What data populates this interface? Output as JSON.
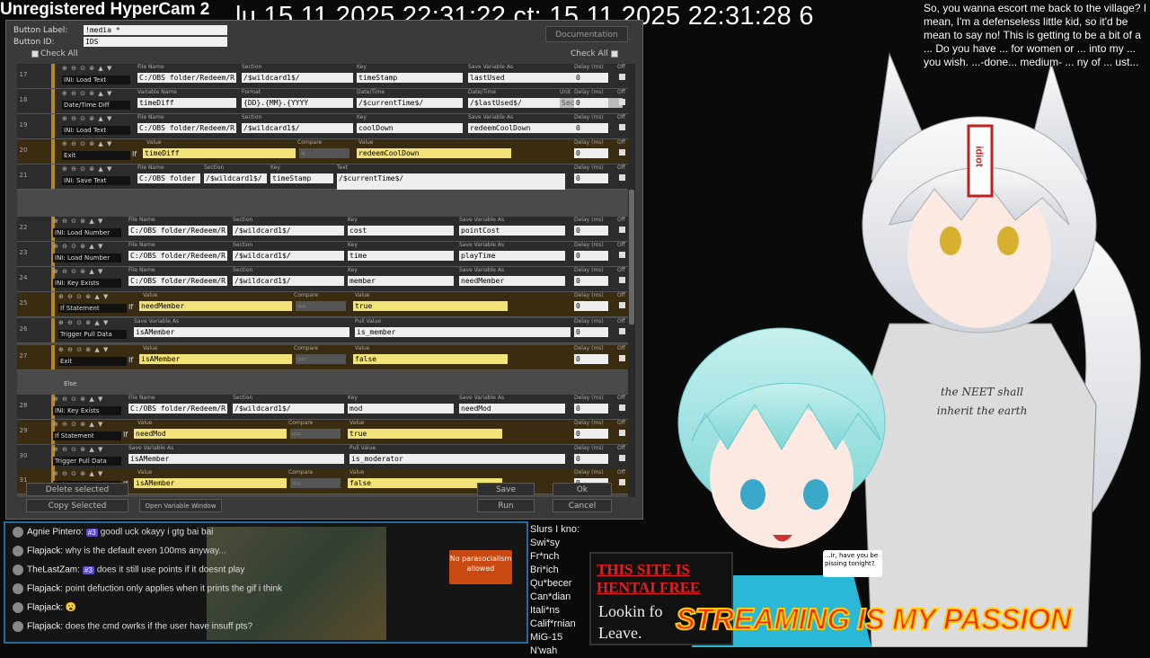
{
  "recorder_watermark": "Unregistered HyperCam 2",
  "clock_text": "lu 15.11.2025 22:31:22 ct: 15.11.2025 22:31:28 6",
  "dialog": {
    "button_label_caption": "Button Label:",
    "button_label_value": "!media *",
    "button_id_caption": "Button ID:",
    "button_id_value": "IDS",
    "documentation_label": "Documentation",
    "check_all_left": "Check All",
    "check_all_right": "Check All",
    "delete_selected": "Delete selected",
    "copy_selected": "Copy Selected",
    "open_variable_window": "Open Variable Window",
    "save": "Save",
    "ok": "Ok",
    "run": "Run",
    "cancel": "Cancel",
    "else_label": "Else",
    "rows": [
      {
        "num": "17",
        "action": "INI: Load Text",
        "kind": "ini",
        "f1l": "File Name",
        "f1": "C:/OBS folder/Redeem/R",
        "f2l": "Section",
        "f2": "/$wildcard1$/",
        "f3l": "Key",
        "f3": "timeStamp",
        "f4l": "Save Variable As",
        "f4": "lastUsed",
        "delay": "0"
      },
      {
        "num": "18",
        "action": "Date/Time Diff",
        "kind": "date",
        "f1l": "Variable Name",
        "f1": "timeDiff",
        "f2l": "Format",
        "f2": "{DD}.{MM}.{YYYY",
        "f3l": "Date/Time",
        "f3": "/$currentTime$/",
        "f4l": "Date/Time",
        "f4": "/$lastUsed$/",
        "f5l": "Unit",
        "f5": "Seconds",
        "delay": "0"
      },
      {
        "num": "19",
        "action": "INI: Load Text",
        "kind": "ini",
        "f1l": "File Name",
        "f1": "C:/OBS folder/Redeem/R",
        "f2l": "Section",
        "f2": "/$wildcard1$/",
        "f3l": "Key",
        "f3": "coolDown",
        "f4l": "Save Variable As",
        "f4": "redeemCoolDown",
        "delay": "0"
      },
      {
        "num": "20",
        "action": "Exit",
        "kind": "if",
        "cond": "If",
        "vl": "Value",
        "v1": "timeDiff",
        "cl": "Compare",
        "c": "<",
        "v2l": "Value",
        "v2": "redeemCoolDown",
        "delay": "0"
      },
      {
        "num": "21",
        "action": "INI: Save Text",
        "kind": "save",
        "f1l": "File Name",
        "f1": "C:/OBS folder",
        "f2l": "Section",
        "f2": "/$wildcard1$/",
        "f3l": "Key",
        "f3": "timeStamp",
        "f4l": "Text",
        "f4": "/$currentTime$/",
        "delay": "0"
      },
      {
        "num": "22",
        "action": "INI: Load Number",
        "kind": "ini",
        "f1l": "File Name",
        "f1": "C:/OBS folder/Redeem/R",
        "f2l": "Section",
        "f2": "/$wildcard1$/",
        "f3l": "Key",
        "f3": "cost",
        "f4l": "Save Variable As",
        "f4": "pointCost",
        "delay": "0"
      },
      {
        "num": "23",
        "action": "INI: Load Number",
        "kind": "ini",
        "f1l": "File Name",
        "f1": "C:/OBS folder/Redeem/R",
        "f2l": "Section",
        "f2": "/$wildcard1$/",
        "f3l": "Key",
        "f3": "time",
        "f4l": "Save Variable As",
        "f4": "playTime",
        "delay": "0"
      },
      {
        "num": "24",
        "action": "INI: Key Exists",
        "kind": "ini",
        "f1l": "File Name",
        "f1": "C:/OBS folder/Redeem/R",
        "f2l": "Section",
        "f2": "/$wildcard1$/",
        "f3l": "Key",
        "f3": "member",
        "f4l": "Save Variable As",
        "f4": "needMember",
        "delay": "0"
      },
      {
        "num": "25",
        "action": "If Statement",
        "kind": "if",
        "cond": "If",
        "vl": "Value",
        "v1": "needMember",
        "cl": "Compare",
        "c": "==",
        "v2l": "Value",
        "v2": "true",
        "delay": "0"
      },
      {
        "num": "26",
        "action": "Trigger Pull Data",
        "kind": "pull",
        "f1l": "Save Variable As",
        "f1": "isAMember",
        "f2l": "Pull Value",
        "f2": "is_member",
        "delay": "0"
      },
      {
        "num": "27",
        "action": "Exit",
        "kind": "if",
        "cond": "If",
        "vl": "Value",
        "v1": "isAMember",
        "cl": "Compare",
        "c": "==",
        "v2l": "Value",
        "v2": "false",
        "delay": "0"
      },
      {
        "num": "28",
        "action": "INI: Key Exists",
        "kind": "ini",
        "f1l": "File Name",
        "f1": "C:/OBS folder/Redeem/R",
        "f2l": "Section",
        "f2": "/$wildcard1$/",
        "f3l": "Key",
        "f3": "mod",
        "f4l": "Save Variable As",
        "f4": "needMod",
        "delay": "0"
      },
      {
        "num": "29",
        "action": "If Statement",
        "kind": "if",
        "cond": "If",
        "vl": "Value",
        "v1": "needMod",
        "cl": "Compare",
        "c": "==",
        "v2l": "Value",
        "v2": "true",
        "delay": "0"
      },
      {
        "num": "30",
        "action": "Trigger Pull Data",
        "kind": "pull",
        "f1l": "Save Variable As",
        "f1": "isAMember",
        "f2l": "Pull Value",
        "f2": "is_moderator",
        "delay": "0"
      },
      {
        "num": "31",
        "action": "Exit",
        "kind": "if",
        "cond": "If",
        "vl": "Value",
        "v1": "isAMember",
        "cl": "Compare",
        "c": "==",
        "v2l": "Value",
        "v2": "false",
        "delay": "0"
      }
    ],
    "delay_label": "Delay (ms)",
    "off_label": "Off"
  },
  "chat": {
    "messages": [
      {
        "user": "Agnie Pintero:",
        "badge": "#3",
        "text": "goodl uck okayy i gtg bai bai"
      },
      {
        "user": "Flapjack:",
        "badge": "",
        "text": "why is the default even 100ms anyway..."
      },
      {
        "user": "TheLastZam:",
        "badge": "#3",
        "text": "does it still use points if it doesnt play"
      },
      {
        "user": "Flapjack:",
        "badge": "",
        "text": "point defuction only applies when it prints the gif i think"
      },
      {
        "user": "Flapjack:",
        "badge": "",
        "text": "😮"
      },
      {
        "user": "Flapjack:",
        "badge": "",
        "text": "does the cmd owrks if the user have insuff pts?"
      }
    ],
    "sign_text": "No parasocialism allowed"
  },
  "side_list": [
    "Slurs I kno:",
    "Swi*sy",
    "Fr*nch",
    "Bri*ich",
    "Qu*becer",
    "Can*dian",
    "Itali*ns",
    "Calif*rnian",
    "MiG-15",
    "N'wah"
  ],
  "site_sign": {
    "line1": "THIS SITE IS",
    "line2": "HENTAI FREE",
    "line3": "Lookin fo",
    "line4": "Leave."
  },
  "top_right_text": "So, you wanna escort me back to the village? I mean, I'm a defenseless little kid, so it'd be mean to say no! This is getting to be a bit of a ... Do you have ... for women or ... into my ... you wish. ...-done... medium- ... ny of ... ust...",
  "shirt_text": "the NEET shall inherit the earth",
  "forehead_tag": "idiot",
  "speech_text": "...ir, have you be pissing tonight?",
  "banner_text": "STREAMING IS MY PASSION"
}
